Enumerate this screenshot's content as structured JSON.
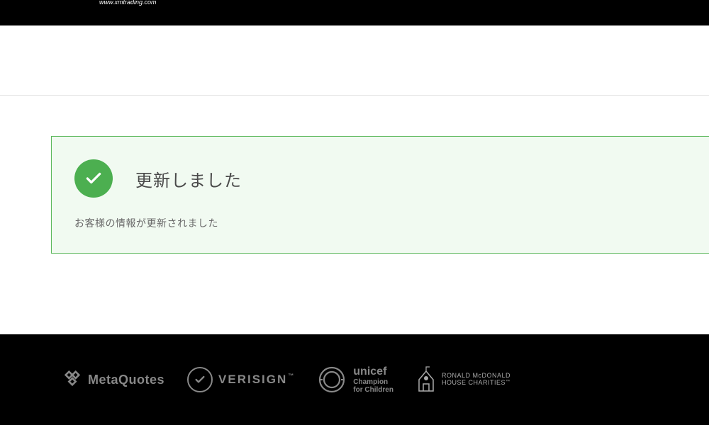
{
  "header": {
    "url": "www.xmtrading.com"
  },
  "success_banner": {
    "title": "更新しました",
    "message": "お客様の情報が更新されました"
  },
  "footer": {
    "partners": {
      "metaquotes": "MetaQuotes",
      "verisign": "VERISIGN",
      "unicef": {
        "main": "unicef",
        "sub1": "Champion",
        "sub2": "for Children"
      },
      "rmhc": {
        "line1": "RONALD McDONALD",
        "line2": "HOUSE CHARITIES"
      }
    }
  }
}
